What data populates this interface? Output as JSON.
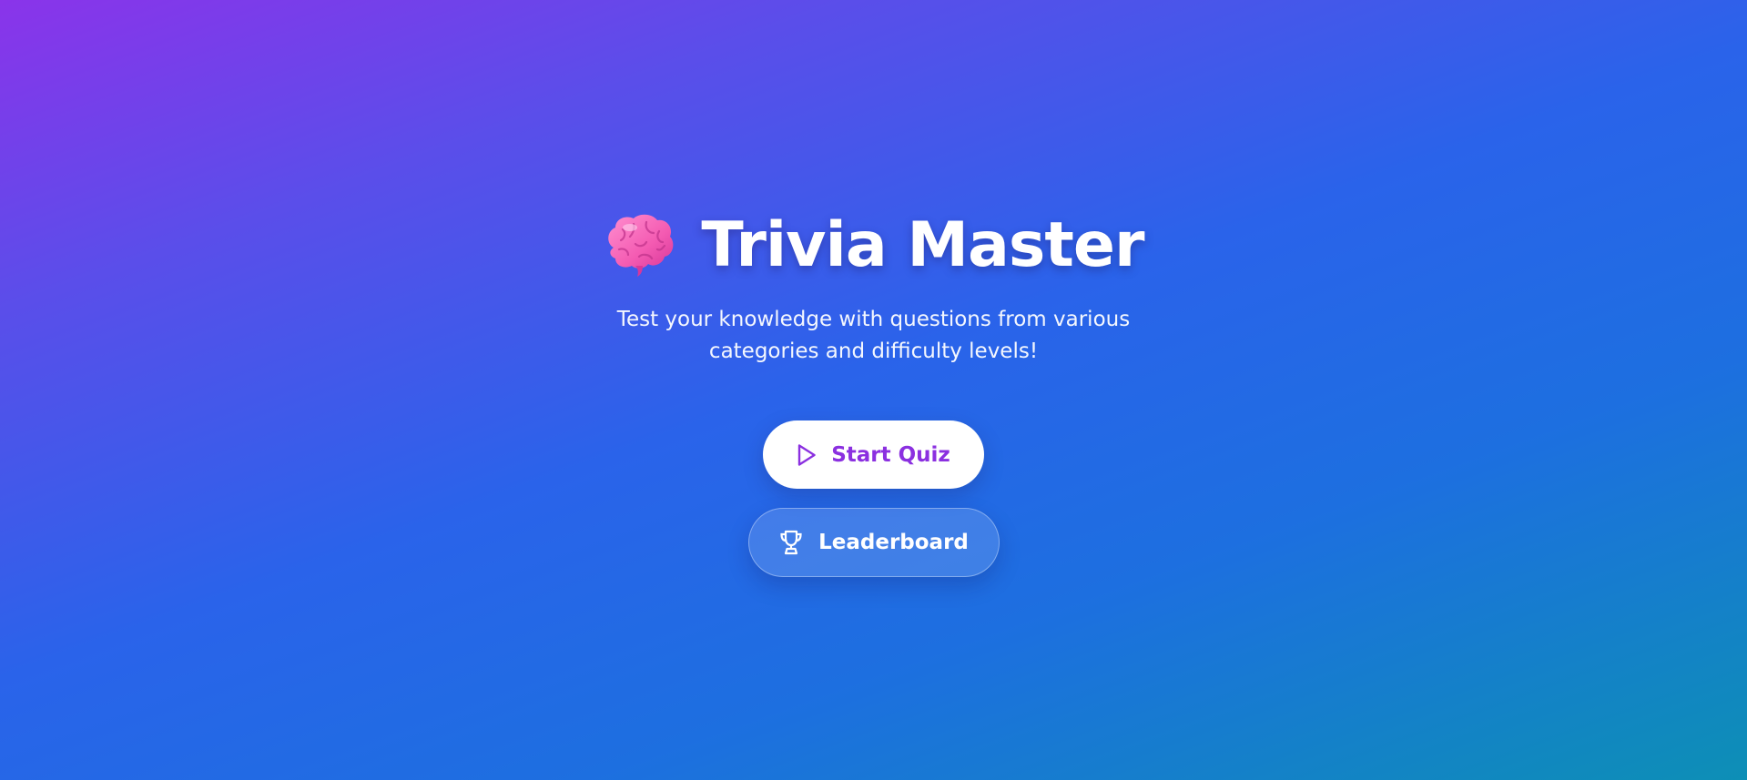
{
  "hero": {
    "title": "Trivia Master",
    "emoji_icon": "brain-icon",
    "subtitle": "Test your knowledge with questions from various categories and difficulty levels!"
  },
  "actions": {
    "start_label": "Start Quiz",
    "start_icon": "play-icon",
    "leaderboard_label": "Leaderboard",
    "leaderboard_icon": "trophy-icon"
  },
  "colors": {
    "gradient_start": "#8a34ea",
    "gradient_mid": "#2a63ea",
    "gradient_end": "#0d8fb6",
    "start_button_text": "#8b30e0",
    "start_button_bg": "#ffffff"
  }
}
